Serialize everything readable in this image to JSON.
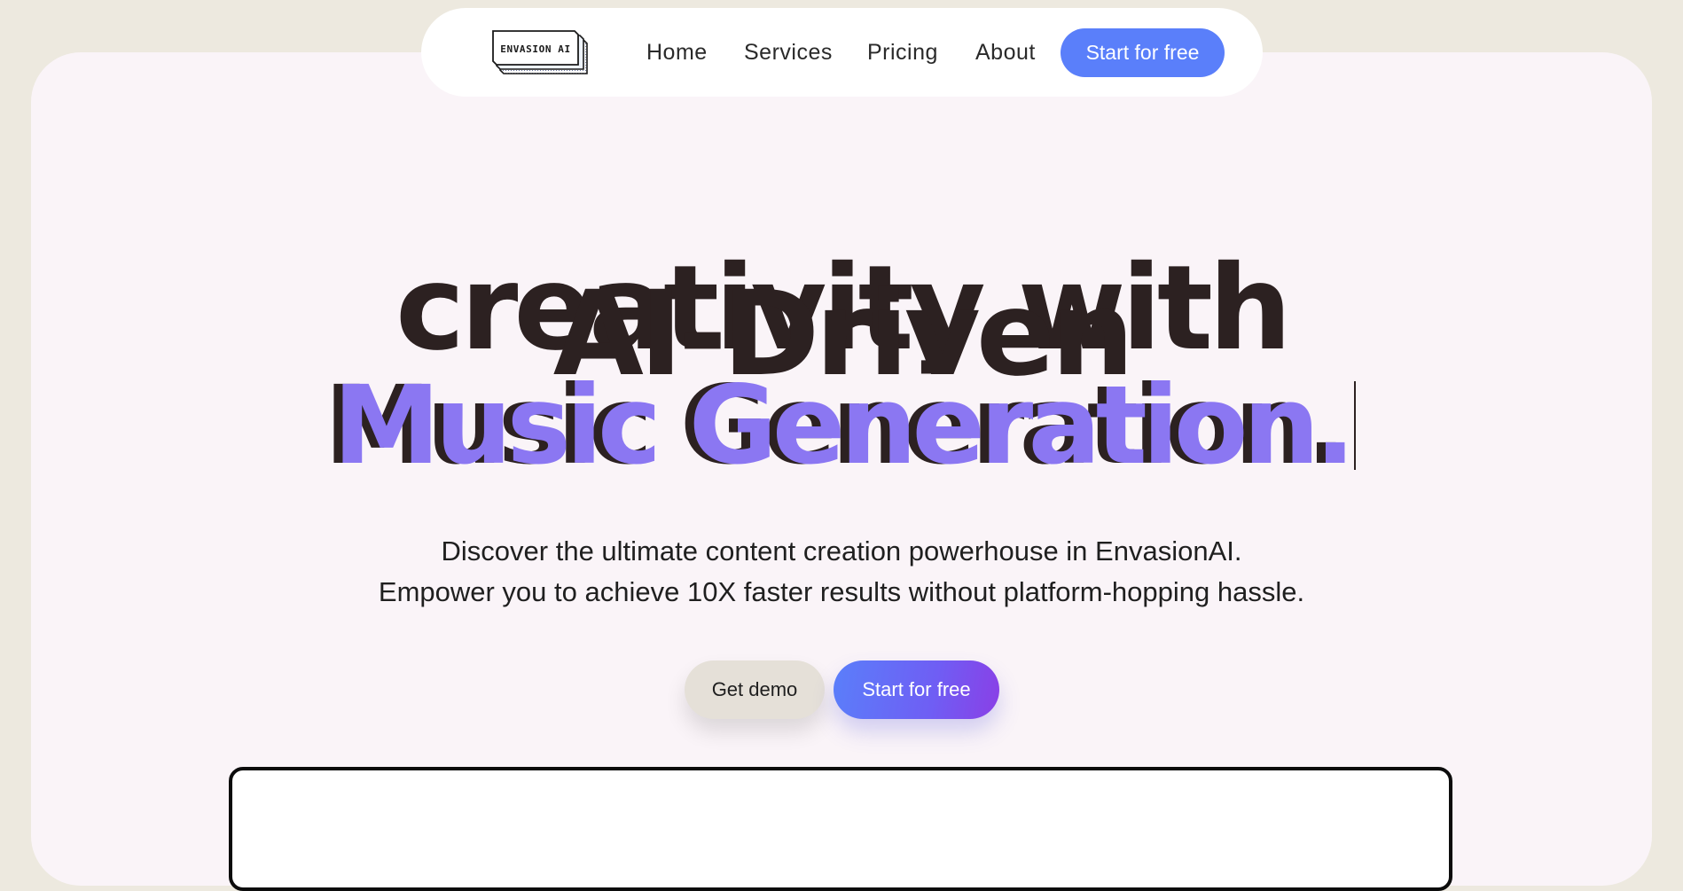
{
  "brand": {
    "logo_text": "ENVASION AI"
  },
  "nav": {
    "items": [
      "Home",
      "Services",
      "Pricing",
      "About"
    ],
    "cta_label": "Start for free"
  },
  "hero": {
    "line1": "creativity with",
    "line2": "AI-Driven",
    "line3": "Music Generation.",
    "subtitle_line1": "Discover the ultimate content creation powerhouse in EnvasionAI.",
    "subtitle_line2": "Empower you to achieve 10X faster results without platform-hopping hassle.",
    "demo_label": "Get demo",
    "start_label": "Start for free"
  },
  "colors": {
    "page_background": "#ede9df",
    "card_background": "#faf4f8",
    "headline_dark": "#2c2121",
    "headline_accent": "#8b77f2",
    "primary_blue": "#5a7ffa",
    "gradient_end_purple": "#8a3fe6",
    "demo_button": "#e5e0d8"
  }
}
